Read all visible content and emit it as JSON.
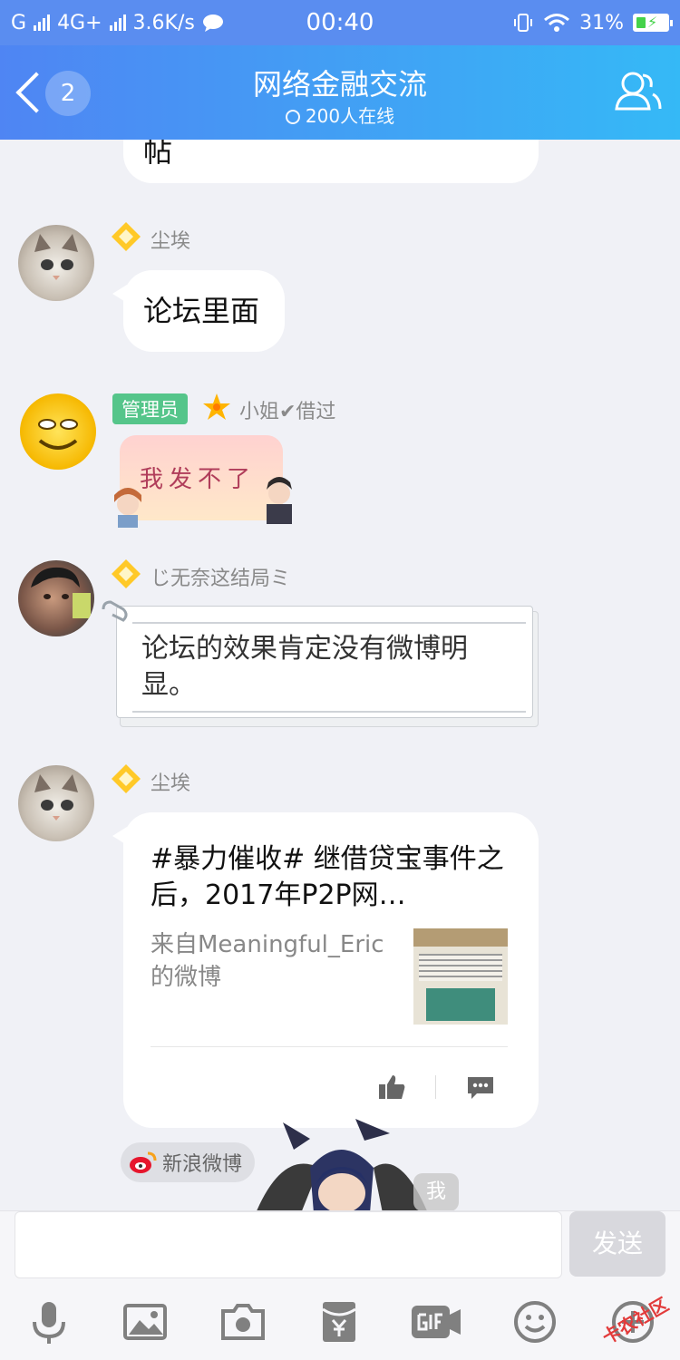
{
  "statusbar": {
    "carrier": "G",
    "network": "4G+",
    "speed": "3.6K/s",
    "time": "00:40",
    "battery": "31%"
  },
  "header": {
    "unread_count": "2",
    "title": "网络金融交流",
    "online": "200人在线"
  },
  "messages": {
    "partial_bubble_text": "帖",
    "m1": {
      "nick": "尘埃",
      "text": "论坛里面"
    },
    "m2": {
      "role": "管理员",
      "nick": "小姐✔借过",
      "sticker_text": "我发不了"
    },
    "m3": {
      "nick": "じ无奈这结局ミ",
      "text": "论坛的效果肯定没有微博明显。"
    },
    "m4": {
      "nick": "尘埃",
      "card_title": "#暴力催收# 继借贷宝事件之后，2017年P2P网…",
      "card_source": "来自Meaningful_Eric 的微博",
      "source_tag": "新浪微博"
    },
    "m5": {
      "me_tag": "我"
    }
  },
  "input": {
    "placeholder": "",
    "send_label": "发送"
  },
  "toolbar": {
    "icons": [
      "microphone-icon",
      "image-icon",
      "camera-icon",
      "red-packet-icon",
      "gif-icon",
      "emoji-icon",
      "plus-icon"
    ]
  },
  "watermark": "卡农社区",
  "colors": {
    "header_start": "#4f85f3",
    "header_end": "#35b9f6",
    "admin_badge": "#55c58a"
  }
}
